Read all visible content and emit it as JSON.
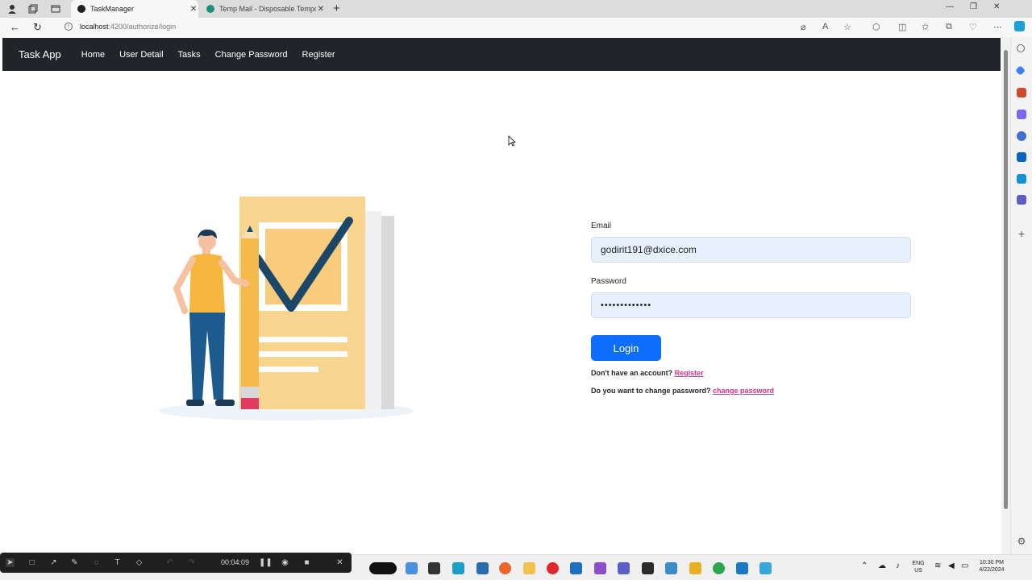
{
  "browser": {
    "tabs": [
      {
        "title": "TaskManager",
        "active": true
      },
      {
        "title": "Temp Mail - Disposable Tempora",
        "active": false
      }
    ],
    "url_host": "localhost",
    "url_path": ":4200/authorize/login"
  },
  "app": {
    "brand": "Task App",
    "nav": [
      "Home",
      "User Detail",
      "Tasks",
      "Change Password",
      "Register"
    ]
  },
  "login_form": {
    "email_label": "Email",
    "email_value": "godirit191@dxice.com",
    "password_label": "Password",
    "password_value": "•••••••••••••",
    "login_button": "Login",
    "no_account_text": "Don't have an account?",
    "register_link": "Register",
    "change_pw_text": "Do you want to change password?",
    "change_pw_link": "change password"
  },
  "recorder": {
    "elapsed": "00:04:09"
  },
  "taskbar": {
    "lang": "ENG",
    "region": "US",
    "time": "10:30 PM",
    "date": "4/22/2024"
  },
  "colors": {
    "navbar": "#212529",
    "primary": "#0d6efd",
    "link": "#d63384",
    "input_bg": "#e8f0fe"
  }
}
